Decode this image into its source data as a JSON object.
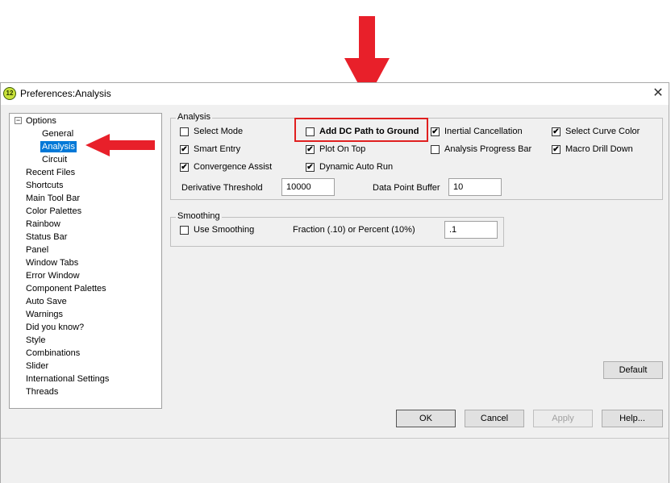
{
  "colors": {
    "annotation_red": "#e8202a",
    "highlight_box": "#e02020",
    "selection": "#0078d7"
  },
  "window": {
    "title": "Preferences:Analysis",
    "app_icon_text": "12",
    "close_glyph": "✕"
  },
  "tree": {
    "expander": "−",
    "root": "Options",
    "children": [
      "General",
      "Analysis",
      "Circuit"
    ],
    "items": [
      "Recent Files",
      "Shortcuts",
      "Main Tool Bar",
      "Color Palettes",
      "Rainbow",
      "Status Bar",
      "Panel",
      "Window Tabs",
      "Error Window",
      "Component Palettes",
      "Auto Save",
      "Warnings",
      "Did you know?",
      "Style",
      "Combinations",
      "Slider",
      "International Settings",
      "Threads"
    ]
  },
  "analysis": {
    "group_label": "Analysis",
    "options": [
      {
        "label": "Select Mode",
        "checked": false
      },
      {
        "label": "Add DC Path to Ground",
        "checked": false
      },
      {
        "label": "Inertial Cancellation",
        "checked": true
      },
      {
        "label": "Select Curve Color",
        "checked": true
      },
      {
        "label": "Smart Entry",
        "checked": true
      },
      {
        "label": "Plot On Top",
        "checked": true
      },
      {
        "label": "Analysis Progress Bar",
        "checked": false
      },
      {
        "label": "Macro Drill Down",
        "checked": true
      },
      {
        "label": "Convergence Assist",
        "checked": true
      },
      {
        "label": "Dynamic Auto Run",
        "checked": true
      }
    ],
    "derivative_threshold_label": "Derivative Threshold",
    "derivative_threshold_value": "10000",
    "data_point_buffer_label": "Data Point Buffer",
    "data_point_buffer_value": "10"
  },
  "smoothing": {
    "group_label": "Smoothing",
    "use_smoothing_label": "Use Smoothing",
    "use_smoothing_checked": false,
    "fraction_label": "Fraction (.10) or Percent (10%)",
    "fraction_value": ".1"
  },
  "buttons": {
    "default": "Default",
    "ok": "OK",
    "cancel": "Cancel",
    "apply": "Apply",
    "help": "Help..."
  },
  "check_glyph": "✔"
}
